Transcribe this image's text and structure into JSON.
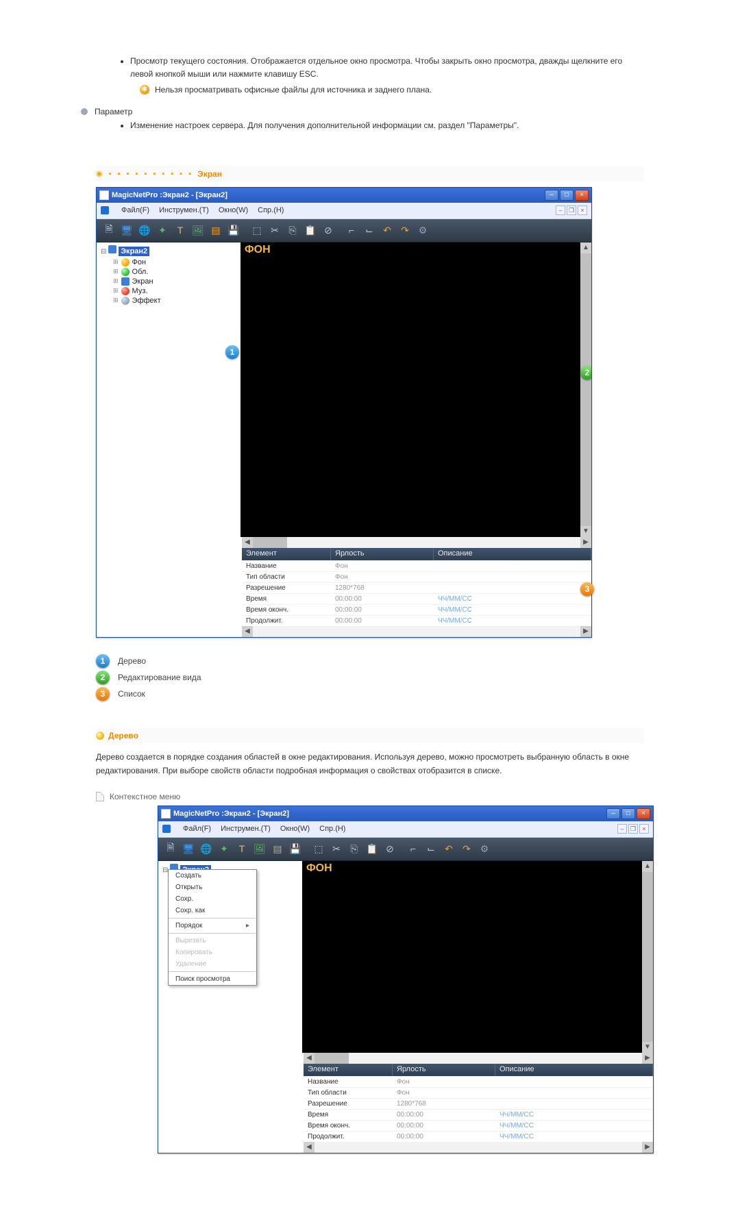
{
  "intro": {
    "previewBullet": "Просмотр текущего состояния. Отображается отдельное окно просмотра. Чтобы закрыть окно просмотра, дважды щелкните его левой кнопкой мыши или нажмите клавишу ESC.",
    "previewNote": "Нельзя просматривать офисные файлы для источника и заднего плана.",
    "paramLabel": "Параметр",
    "paramBullet": "Изменение настроек сервера. Для получения дополнительной информации см. раздел \"Параметры\"."
  },
  "section1": {
    "dots": "◉ ▪ ▪ ▪ ▪ ▪ ▪ ▪ ▪ ▪ ▪",
    "title": "Экран"
  },
  "app": {
    "windowTitle": "MagicNetPro :Экран2 - [Экран2]",
    "menus": {
      "file": {
        "text": "Файл(F)",
        "u": "F"
      },
      "tools": {
        "text": "Инструмен.(T)",
        "u": "T"
      },
      "window": {
        "text": "Окно(W)",
        "u": "W"
      },
      "help": {
        "text": "Спр.(H)",
        "u": "H"
      }
    },
    "tree": {
      "root": "Экран2",
      "items": [
        {
          "icon": "yellow",
          "label": "Фон"
        },
        {
          "icon": "green",
          "label": "Обл."
        },
        {
          "icon": "screen",
          "label": "Экран"
        },
        {
          "icon": "red",
          "label": "Муз."
        },
        {
          "icon": "gray",
          "label": "Эффект"
        }
      ]
    },
    "canvasLabel": "ФОН",
    "listHeaders": {
      "c1": "Элемент",
      "c2": "Ярлость",
      "c3": "Описание"
    },
    "listRows": [
      {
        "c1": "Название",
        "c2": "Фон",
        "c3": ""
      },
      {
        "c1": "Тип области",
        "c2": "Фон",
        "c3": ""
      },
      {
        "c1": "Разрешение",
        "c2": "1280*768",
        "c3": ""
      },
      {
        "c1": "Время",
        "c2": "00:00:00",
        "c3": "ЧЧ/ММ/СС"
      },
      {
        "c1": "Время оконч.",
        "c2": "00:00:00",
        "c3": "ЧЧ/ММ/СС"
      },
      {
        "c1": "Продолжит.",
        "c2": "00:00:00",
        "c3": "ЧЧ/ММ/СС"
      }
    ]
  },
  "legend": {
    "1": "Дерево",
    "2": "Редактирование вида",
    "3": "Список"
  },
  "section2": {
    "title": "Дерево",
    "body": "Дерево создается в порядке создания областей в окне редактирования. Используя дерево, можно просмотреть выбранную область в окне редактирования. При выборе свойств области подробная информация о свойствах отобразится в списке.",
    "subhead": "Контекстное меню"
  },
  "contextMenu": {
    "items": [
      {
        "label": "Создать",
        "type": "item"
      },
      {
        "label": "Открыть",
        "type": "item"
      },
      {
        "label": "Сохр.",
        "type": "item"
      },
      {
        "label": "Сохр. как",
        "type": "item"
      },
      {
        "type": "sep"
      },
      {
        "label": "Порядок",
        "type": "sub"
      },
      {
        "type": "sep"
      },
      {
        "label": "Вырезать",
        "type": "disabled"
      },
      {
        "label": "Копировать",
        "type": "disabled"
      },
      {
        "label": "Удаление",
        "type": "disabled"
      },
      {
        "type": "sep"
      },
      {
        "label": "Поиск просмотра",
        "type": "item"
      }
    ]
  },
  "callouts": {
    "1": "1",
    "2": "2",
    "3": "3"
  }
}
